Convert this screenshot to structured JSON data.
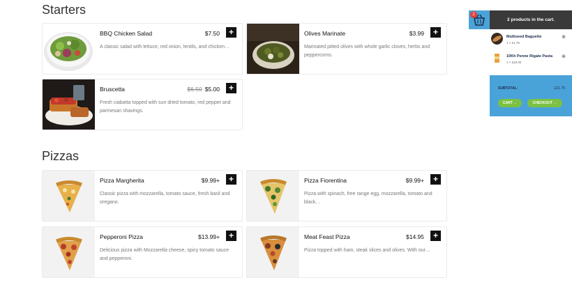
{
  "sections": {
    "starters": "Starters",
    "pizzas": "Pizzas"
  },
  "starters": [
    {
      "name": "BBQ Chicken Salad",
      "price": "$7.50",
      "old_price": "",
      "desc": "A classic salad with lettuce, red onion, lentils, and chicken…"
    },
    {
      "name": "Olives Marinate",
      "price": "$3.99",
      "old_price": "",
      "desc": "Marinated pitted olives with whole garlic cloves, herbs and peppercorns."
    },
    {
      "name": "Bruscetta",
      "price": "$5.00",
      "old_price": "$6.50",
      "desc": "Fresh ciabatta topped with sun dried tomato, red pepper and parmesan shavings."
    }
  ],
  "pizzas": [
    {
      "name": "Pizza Margherita",
      "price": "$9.99+",
      "desc": "Classic pizza with mozzarella, tomato sauce, fresh basil and oregano."
    },
    {
      "name": "Pizza Fiorentina",
      "price": "$9.99+",
      "desc": "Pizza with spinach, free range egg, mozzarella, tomato and black…"
    },
    {
      "name": "Pepperoni Pizza",
      "price": "$13.99+",
      "desc": "Delicious pizza with Mozzarella cheese, spicy tomato sauce and pepperoni."
    },
    {
      "name": "Meat Feast Pizza",
      "price": "$14.95",
      "desc": "Pizza topped with ham, steak slices and olives. With our…"
    }
  ],
  "add_label": "+",
  "cart": {
    "count": "2",
    "title": "2 products in the cart.",
    "items": [
      {
        "name": "Multiseed Baguette",
        "meta": "1 × £1.75"
      },
      {
        "name": "10Kh Penne Rigate Pasta",
        "meta": "1 × £20.00"
      }
    ],
    "remove_glyph": "⊗",
    "subtotal_label": "SUBTOTAL:",
    "subtotal_value": "£21.75",
    "cart_button": "CART →",
    "checkout_button": "CHECKOUT →"
  },
  "colors": {
    "accent_blue": "#4aa3d8",
    "accent_green": "#7cc142",
    "dark": "#3a3a3a"
  }
}
